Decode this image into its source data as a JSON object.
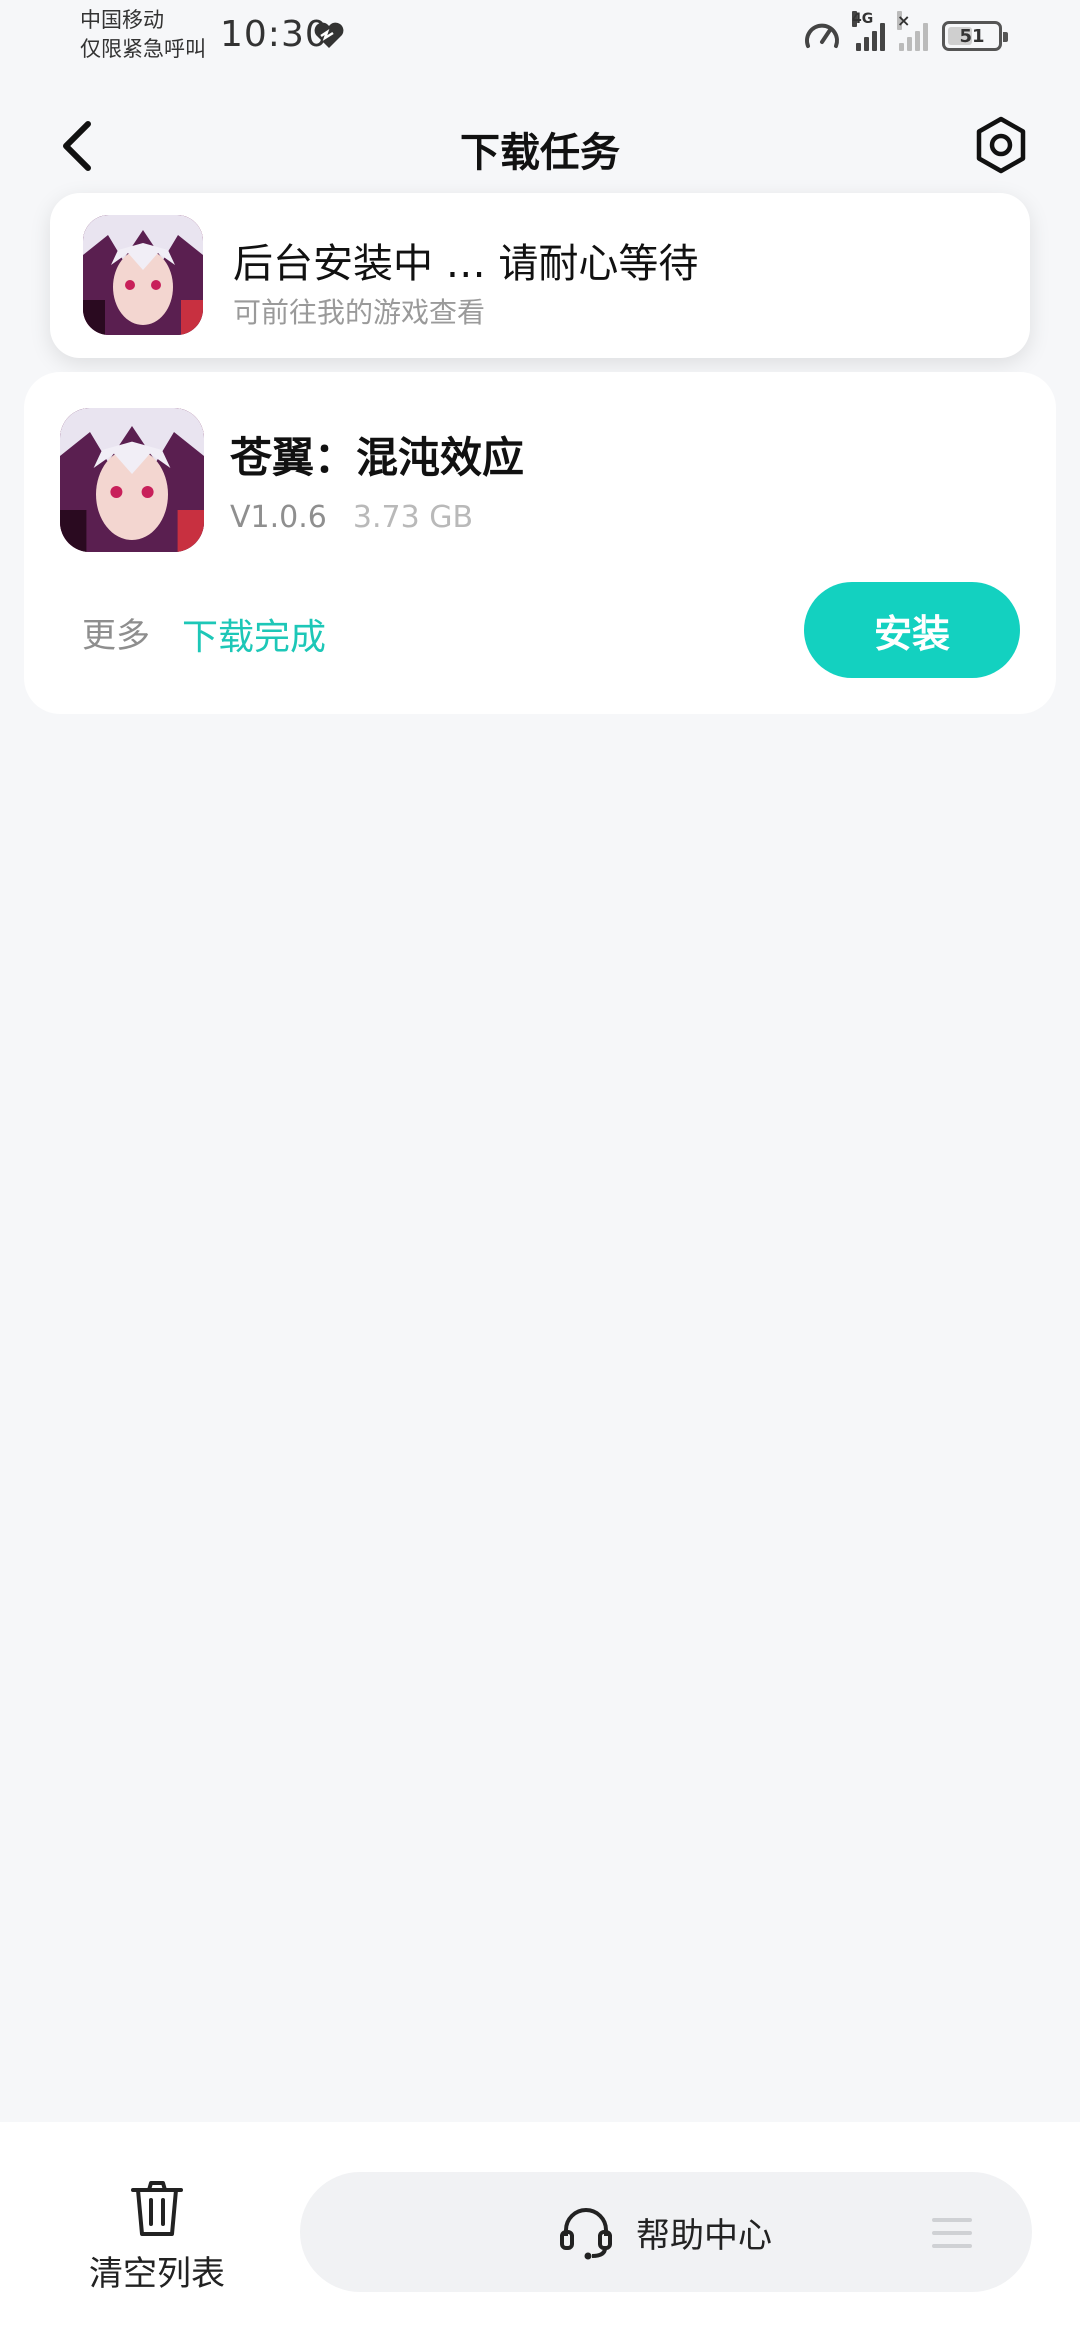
{
  "status_bar": {
    "carrier_line1": "中国移动",
    "carrier_line2": "仅限紧急呼叫",
    "time": "10:30",
    "network": "4G",
    "battery_level": "51"
  },
  "header": {
    "title": "下载任务"
  },
  "notice": {
    "title": "后台安装中 … 请耐心等待",
    "subtitle": "可前往我的游戏查看"
  },
  "task": {
    "game_name": "苍翼：混沌效应",
    "version": "V1.0.6",
    "size": "3.73 GB",
    "more_label": "更多",
    "status": "下载完成",
    "install_label": "安装"
  },
  "bottom_bar": {
    "clear_label": "清空列表",
    "help_label": "帮助中心"
  },
  "colors": {
    "accent": "#13d1c0",
    "status_text": "#1dc7b7",
    "background": "#f6f7f9"
  },
  "icons": [
    "heart-icon",
    "speed-icon",
    "back-icon",
    "settings-icon",
    "trash-icon",
    "headset-icon",
    "menu-icon"
  ]
}
